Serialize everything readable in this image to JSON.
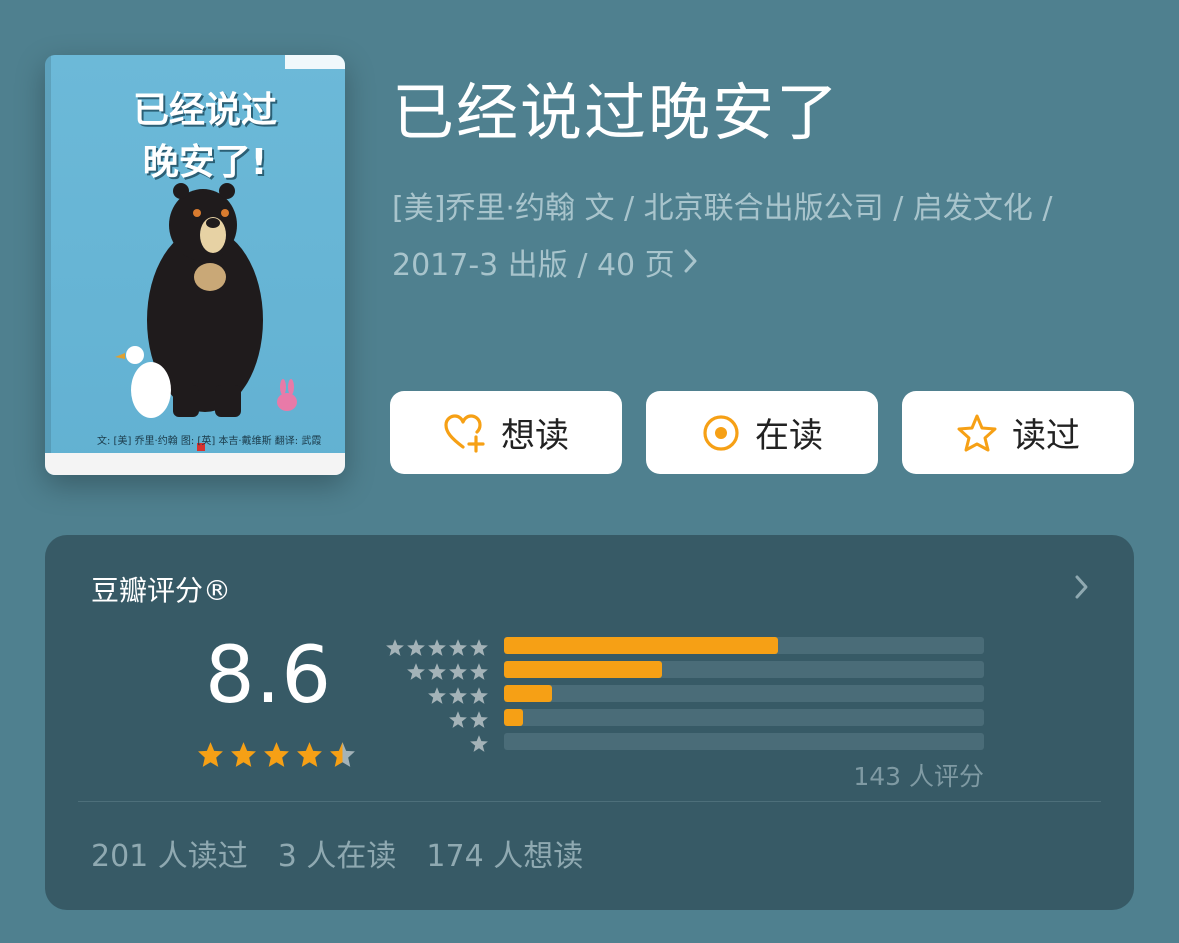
{
  "book": {
    "title": "已经说过晚安了",
    "cover_title": "已经说过\n晚安了!",
    "cover_credits": "文: [美] 乔里·约翰    图: [英] 本吉·戴维斯    翻译: 武霞",
    "meta_line1": "[美]乔里·约翰 文 / 北京联合出版公司 / 启发文化 /",
    "meta_line2": "2017-3 出版 / 40 页"
  },
  "actions": {
    "want": {
      "label": "想读",
      "icon": "heart-plus-icon"
    },
    "reading": {
      "label": "在读",
      "icon": "target-circle-icon"
    },
    "read": {
      "label": "读过",
      "icon": "star-outline-icon"
    }
  },
  "rating": {
    "title": "豆瓣评分®",
    "score": "8.6",
    "stars": 4.5,
    "raters": "143 人评分",
    "distribution": [
      0.57,
      0.33,
      0.1,
      0.04,
      0
    ]
  },
  "stats": {
    "read": "201 人读过",
    "reading": "3 人在读",
    "want": "174 人想读"
  },
  "colors": {
    "background": "#4f808f",
    "panel": "#375a66",
    "accent": "#f6a015",
    "star_gray": "#a4b3b8"
  }
}
